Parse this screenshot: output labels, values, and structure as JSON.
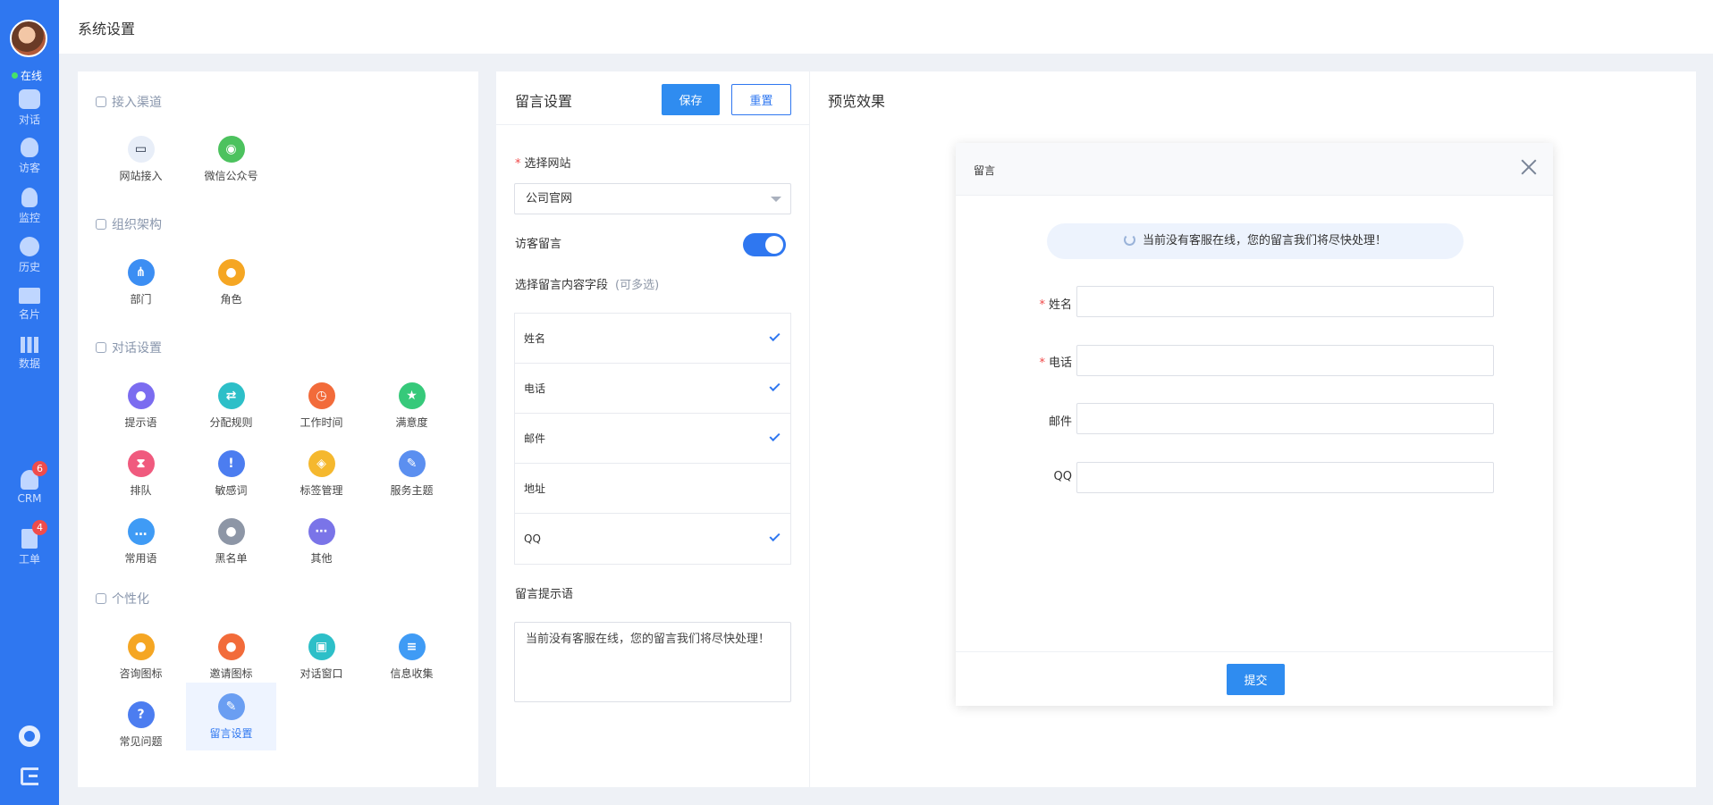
{
  "rail": {
    "status": "在线",
    "items": [
      {
        "label": "对话",
        "icon": "chat-icon"
      },
      {
        "label": "访客",
        "icon": "footprint-icon"
      },
      {
        "label": "监控",
        "icon": "monitor-icon"
      },
      {
        "label": "历史",
        "icon": "clock-icon"
      },
      {
        "label": "名片",
        "icon": "card-icon"
      },
      {
        "label": "数据",
        "icon": "bar-chart-icon"
      },
      {
        "label": "CRM",
        "icon": "crm-icon",
        "badge": "6"
      },
      {
        "label": "工单",
        "icon": "ticket-icon",
        "badge": "4"
      }
    ]
  },
  "header": {
    "title": "系统设置"
  },
  "settings": {
    "sections": {
      "access": "接入渠道",
      "org": "组织架构",
      "dialog": "对话设置",
      "personal": "个性化"
    },
    "tiles": {
      "web": "网站接入",
      "wechat": "微信公众号",
      "dept": "部门",
      "role": "角色",
      "tips": "提示语",
      "assign": "分配规则",
      "worktime": "工作时间",
      "satisfaction": "满意度",
      "queue": "排队",
      "sensitive": "敏感词",
      "tags": "标签管理",
      "theme": "服务主题",
      "phrases": "常用语",
      "blacklist": "黑名单",
      "other": "其他",
      "consult_icon": "咨询图标",
      "invite_icon": "邀请图标",
      "chat_window": "对话窗口",
      "info_collect": "信息收集",
      "faq": "常见问题",
      "message_settings": "留言设置"
    }
  },
  "message_settings": {
    "title": "留言设置",
    "save_label": "保存",
    "reset_label": "重置",
    "site_label": "选择网站",
    "site_value": "公司官网",
    "visitor_message_label": "访客留言",
    "visitor_message_enabled": true,
    "fields_label": "选择留言内容字段",
    "fields_hint": "(可多选)",
    "fields": [
      {
        "name": "姓名",
        "checked": true
      },
      {
        "name": "电话",
        "checked": true
      },
      {
        "name": "邮件",
        "checked": true
      },
      {
        "name": "地址",
        "checked": false
      },
      {
        "name": "QQ",
        "checked": true
      }
    ],
    "prompt_label": "留言提示语",
    "prompt_value": "当前没有客服在线，您的留言我们将尽快处理！"
  },
  "preview": {
    "title": "预览效果",
    "modal_title": "留言",
    "notice": "当前没有客服在线，您的留言我们将尽快处理！",
    "fields": [
      {
        "label": "姓名",
        "required": true
      },
      {
        "label": "电话",
        "required": true
      },
      {
        "label": "邮件",
        "required": false
      },
      {
        "label": "QQ",
        "required": false
      }
    ],
    "submit_label": "提交"
  },
  "colors": {
    "primary": "#2f77f0",
    "button": "#2f8cf0",
    "badge": "#ef4c4c",
    "required": "#f04848"
  }
}
